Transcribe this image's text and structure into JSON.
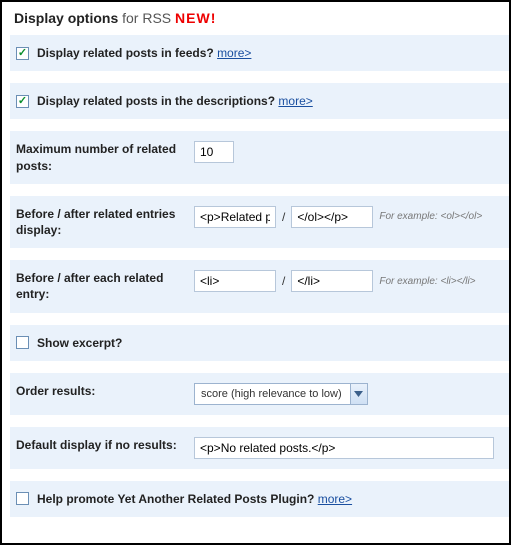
{
  "title": {
    "main": "Display options",
    "for": "for RSS",
    "new": "NEW!"
  },
  "rows": {
    "feeds": {
      "label": "Display related posts in feeds?",
      "more": "more>",
      "checked": true
    },
    "desc": {
      "label": "Display related posts in the descriptions?",
      "more": "more>",
      "checked": true
    },
    "max": {
      "label": "Maximum number of related posts:",
      "value": "10"
    },
    "beforeAfterDisplay": {
      "label": "Before / after related entries display:",
      "before": "<p>Related p",
      "after": "</ol></p>",
      "example": "For example: <ol></ol>"
    },
    "beforeAfterEntry": {
      "label": "Before / after each related entry:",
      "before": "<li>",
      "after": "</li>",
      "example": "For example: <li></li>"
    },
    "excerpt": {
      "label": "Show excerpt?",
      "checked": false
    },
    "order": {
      "label": "Order results:",
      "selected": "score (high relevance to low)"
    },
    "default": {
      "label": "Default display if no results:",
      "value": "<p>No related posts.</p>"
    },
    "promote": {
      "label": "Help promote Yet Another Related Posts Plugin?",
      "more": "more>",
      "checked": false
    }
  }
}
